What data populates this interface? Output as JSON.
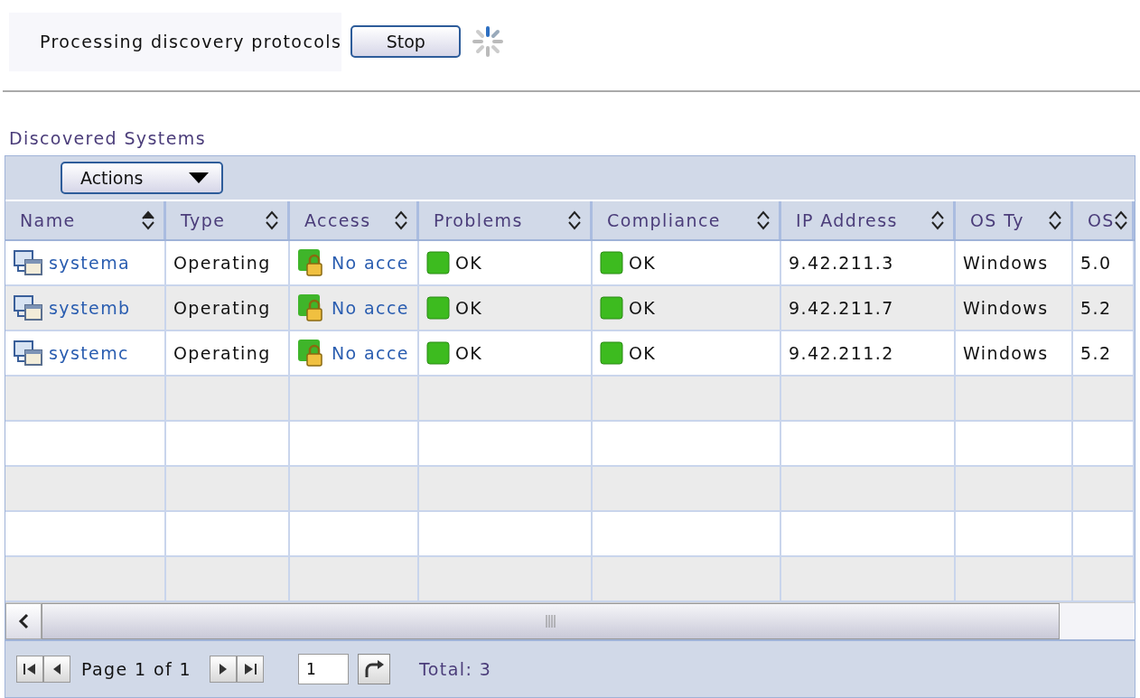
{
  "progress": {
    "message": "Processing discovery protocols",
    "stop_button": "Stop"
  },
  "section_title": "Discovered Systems",
  "toolbar": {
    "actions_button": "Actions"
  },
  "table": {
    "columns": [
      {
        "label": "Name",
        "sorted": true
      },
      {
        "label": "Type",
        "sorted": false
      },
      {
        "label": "Access",
        "sorted": false
      },
      {
        "label": "Problems",
        "sorted": false
      },
      {
        "label": "Compliance",
        "sorted": false
      },
      {
        "label": "IP Address",
        "sorted": false
      },
      {
        "label": "OS Ty",
        "sorted": false
      },
      {
        "label": "OS",
        "sorted": false
      }
    ],
    "rows": [
      {
        "name": "systema",
        "type": "Operating",
        "access": "No acce",
        "problems": "OK",
        "compliance": "OK",
        "ip_address": "9.42.211.3",
        "os_type": "Windows",
        "os": "5.0"
      },
      {
        "name": "systemb",
        "type": "Operating",
        "access": "No acce",
        "problems": "OK",
        "compliance": "OK",
        "ip_address": "9.42.211.7",
        "os_type": "Windows",
        "os": "5.2"
      },
      {
        "name": "systemc",
        "type": "Operating",
        "access": "No acce",
        "problems": "OK",
        "compliance": "OK",
        "ip_address": "9.42.211.2",
        "os_type": "Windows",
        "os": "5.2"
      }
    ]
  },
  "pagination": {
    "page_label": "Page 1 of 1",
    "page_input": "1",
    "total": "Total: 3"
  }
}
